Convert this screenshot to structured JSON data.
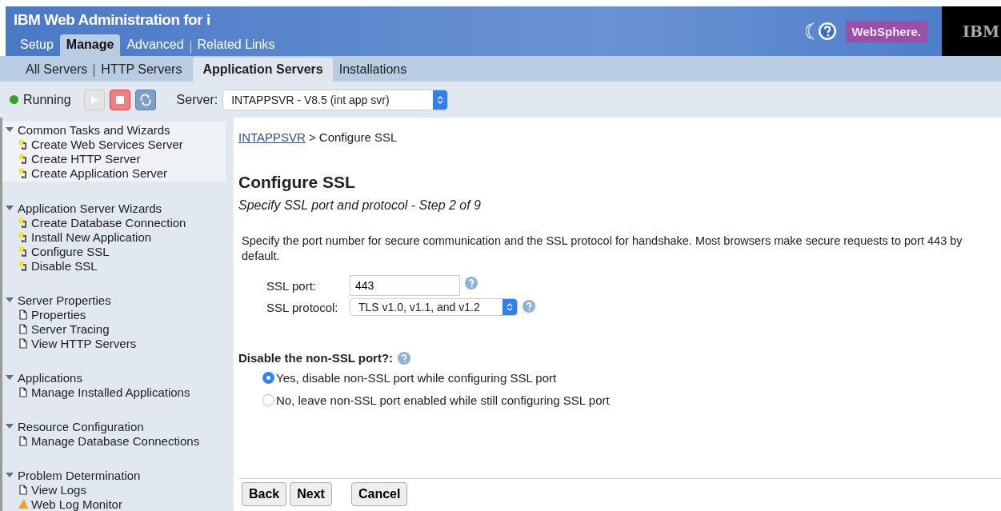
{
  "banner": {
    "title": "IBM Web Administration for i",
    "brand": "WebSphere.",
    "logo": "IBM"
  },
  "tabs": [
    {
      "label": "Setup",
      "selected": false
    },
    {
      "label": "Manage",
      "selected": true
    },
    {
      "label": "Advanced",
      "selected": false
    },
    {
      "label": "Related Links",
      "selected": false
    }
  ],
  "subtabs": [
    {
      "label": "All Servers",
      "selected": false
    },
    {
      "label": "HTTP Servers",
      "selected": false
    },
    {
      "label": "Application Servers",
      "selected": true
    },
    {
      "label": "Installations",
      "selected": false
    }
  ],
  "toolbar": {
    "status": "Running",
    "start_disabled": true,
    "server_label": "Server:",
    "server_value": "INTAPPSVR - V8.5 (int app svr)"
  },
  "sidebar": [
    {
      "title": "Common Tasks and Wizards",
      "expanded": true,
      "selected": true,
      "items": [
        {
          "label": "Create Web Services Server",
          "kind": "wizard"
        },
        {
          "label": "Create HTTP Server",
          "kind": "wizard"
        },
        {
          "label": "Create Application Server",
          "kind": "wizard"
        }
      ]
    },
    {
      "title": "Application Server Wizards",
      "expanded": true,
      "selected": false,
      "items": [
        {
          "label": "Create Database Connection",
          "kind": "wizard"
        },
        {
          "label": "Install New Application",
          "kind": "wizard"
        },
        {
          "label": "Configure SSL",
          "kind": "wizard"
        },
        {
          "label": "Disable SSL",
          "kind": "wizard"
        }
      ]
    },
    {
      "title": "Server Properties",
      "expanded": true,
      "selected": false,
      "items": [
        {
          "label": "Properties",
          "kind": "page"
        },
        {
          "label": "Server Tracing",
          "kind": "page"
        },
        {
          "label": "View HTTP Servers",
          "kind": "page"
        }
      ]
    },
    {
      "title": "Applications",
      "expanded": true,
      "selected": false,
      "items": [
        {
          "label": "Manage Installed Applications",
          "kind": "page"
        }
      ]
    },
    {
      "title": "Resource Configuration",
      "expanded": true,
      "selected": false,
      "items": [
        {
          "label": "Manage Database Connections",
          "kind": "page"
        }
      ]
    },
    {
      "title": "Problem Determination",
      "expanded": true,
      "selected": false,
      "items": [
        {
          "label": "View Logs",
          "kind": "page"
        },
        {
          "label": "Web Log Monitor",
          "kind": "monitor"
        }
      ]
    }
  ],
  "breadcrumb": {
    "link": "INTAPPSVR",
    "current": "> Configure SSL"
  },
  "heading": "Configure SSL",
  "subheading": "Specify SSL port and protocol - Step 2 of 9",
  "description": "Specify the port number for secure communication and the SSL protocol for handshake. Most browsers make secure requests to port 443 by default.",
  "fields": [
    {
      "label": "SSL port:",
      "kind": "text",
      "value": "443"
    },
    {
      "label": "SSL protocol:",
      "kind": "select",
      "value": "TLS v1.0, v1.1, and v1.2"
    }
  ],
  "question": "Disable the non-SSL port?:",
  "options": [
    {
      "label": "Yes, disable non-SSL port while configuring SSL port",
      "selected": true
    },
    {
      "label": "No, leave non-SSL port enabled while still configuring SSL port",
      "selected": false
    }
  ],
  "buttons": [
    "Back",
    "Next",
    "Cancel"
  ]
}
